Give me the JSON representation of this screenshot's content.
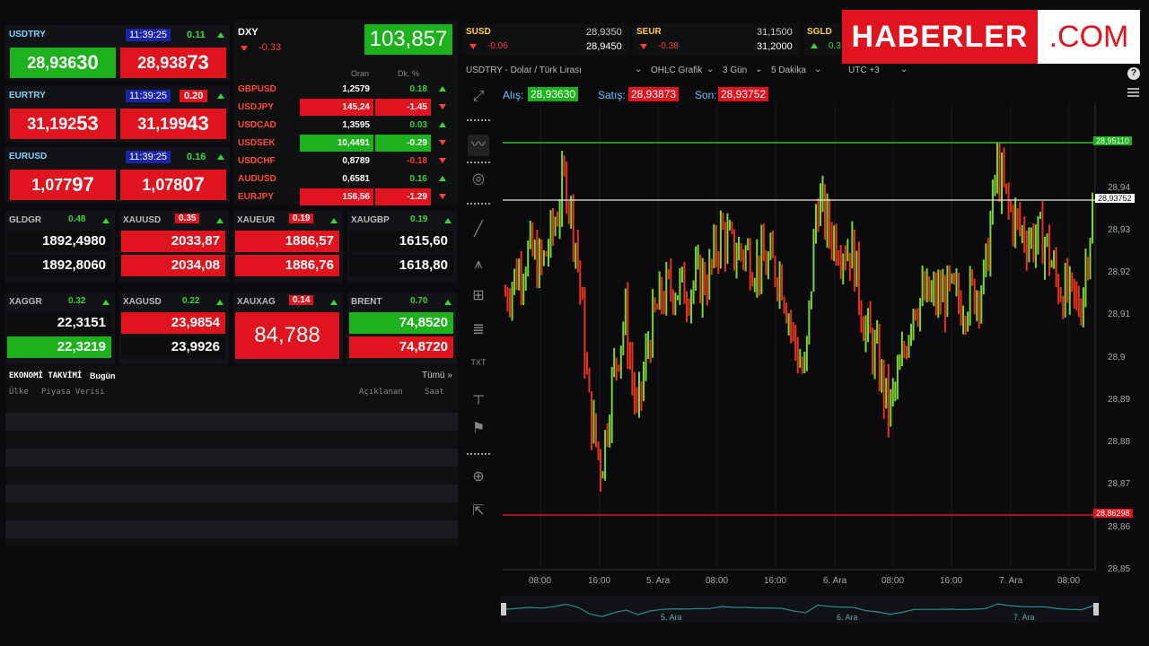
{
  "brand": {
    "name": "HABERLER",
    "suffix": ".COM"
  },
  "help_icon": "question-icon",
  "menu_icon": "hamburger-icon",
  "fx_cards": [
    {
      "symbol": "USDTRY",
      "time": "11:39:25",
      "change": "0.11",
      "dir": "up",
      "bid_main": "28,936",
      "bid_tail": "30",
      "ask_main": "28,938",
      "ask_tail": "73",
      "bid_color": "green",
      "ask_color": "red"
    },
    {
      "symbol": "EURTRY",
      "time": "11:39:25",
      "change": "0.20",
      "dir": "up",
      "bid_main": "31,192",
      "bid_tail": "53",
      "ask_main": "31,199",
      "ask_tail": "43",
      "bid_color": "red",
      "ask_color": "red"
    },
    {
      "symbol": "EURUSD",
      "time": "11:39:25",
      "change": "0.16",
      "dir": "up",
      "bid_main": "1,077",
      "bid_tail": "97",
      "ask_main": "1,078",
      "ask_tail": "07",
      "bid_color": "red",
      "ask_color": "red"
    }
  ],
  "dxy": {
    "symbol": "DXY",
    "change": "-0.33",
    "value": "103,857"
  },
  "fx_table": {
    "col_rate": "Oran",
    "col_pct": "Dk. %",
    "rows": [
      {
        "name": "GBPUSD",
        "rate": "1,2579",
        "pct": "0.18",
        "dir": "up",
        "rate_bg": "",
        "pct_bg": ""
      },
      {
        "name": "USDJPY",
        "rate": "145,24",
        "pct": "-1.45",
        "dir": "down",
        "rate_bg": "red",
        "pct_bg": "red"
      },
      {
        "name": "USDCAD",
        "rate": "1,3595",
        "pct": "0.03",
        "dir": "up",
        "rate_bg": "",
        "pct_bg": ""
      },
      {
        "name": "USDSEK",
        "rate": "10,4491",
        "pct": "-0.29",
        "dir": "down",
        "rate_bg": "green",
        "pct_bg": "green"
      },
      {
        "name": "USDCHF",
        "rate": "0,8789",
        "pct": "-0.18",
        "dir": "down",
        "rate_bg": "",
        "pct_bg": ""
      },
      {
        "name": "AUDUSD",
        "rate": "0,6581",
        "pct": "0.16",
        "dir": "up",
        "rate_bg": "",
        "pct_bg": ""
      },
      {
        "name": "EURJPY",
        "rate": "156,56",
        "pct": "-1.29",
        "dir": "down",
        "rate_bg": "red",
        "pct_bg": "red"
      }
    ]
  },
  "metals_row1": [
    {
      "symbol": "GLDGR",
      "change": "0.48",
      "dir": "up",
      "bid": "1892,4980",
      "ask": "1892,8060",
      "bid_bg": "none",
      "ask_bg": "none"
    },
    {
      "symbol": "XAUUSD",
      "change": "0.35",
      "dir": "up",
      "bid": "2033,87",
      "ask": "2034,08",
      "bid_bg": "red",
      "ask_bg": "red"
    },
    {
      "symbol": "XAUEUR",
      "change": "0.19",
      "dir": "up",
      "bid": "1886,57",
      "ask": "1886,76",
      "bid_bg": "red",
      "ask_bg": "red"
    },
    {
      "symbol": "XAUGBP",
      "change": "0.19",
      "dir": "up",
      "bid": "1615,60",
      "ask": "1618,80",
      "bid_bg": "none",
      "ask_bg": "none"
    }
  ],
  "metals_row2": [
    {
      "symbol": "XAGGR",
      "change": "0.32",
      "dir": "up",
      "bid": "22,3151",
      "ask": "22,3219",
      "bid_bg": "none",
      "ask_bg": "green"
    },
    {
      "symbol": "XAGUSD",
      "change": "0.22",
      "dir": "up",
      "bid": "23,9854",
      "ask": "23,9926",
      "bid_bg": "red",
      "ask_bg": "none"
    },
    {
      "symbol": "XAUXAG",
      "change": "0.14",
      "dir": "up",
      "value": "84,788"
    },
    {
      "symbol": "BRENT",
      "change": "0.70",
      "dir": "up",
      "bid": "74,8520",
      "ask": "74,8720",
      "bid_bg": "green",
      "ask_bg": "red"
    }
  ],
  "calendar": {
    "title": "EKONOMİ TAKVİMİ",
    "today": "Bugün",
    "all": "Tümü »",
    "col_country": "Ülke",
    "col_data": "Piyasa Verisi",
    "col_announced": "Açıklanan",
    "col_time": "Saat"
  },
  "top_tickers": [
    {
      "symbol": "SUSD",
      "change": "-0.06",
      "v1": "28,9350",
      "v2": "28,9450"
    },
    {
      "symbol": "SEUR",
      "change": "-0.38",
      "v1": "31,1500",
      "v2": "31,2000"
    },
    {
      "symbol": "SGLD",
      "change": "0.3"
    }
  ],
  "chart_toolbar": {
    "instrument": "USDTRY - Dolar / Türk Lirası",
    "chart_type": "OHLC Grafik",
    "range": "3 Gün",
    "interval": "5 Dakika",
    "tz": "UTC +3"
  },
  "quote": {
    "bid_label": "Alış:",
    "bid": "28,93630",
    "ask_label": "Satış:",
    "ask": "28,93873",
    "last_label": "Son:",
    "last": "28,93752"
  },
  "levels": {
    "high": "28,95110",
    "last": "28,93752",
    "low": "28,86298"
  },
  "colors": {
    "up": "#3bd43b",
    "down": "#ff3b3b",
    "green_bg": "#1db21d",
    "red_bg": "#e0141f"
  },
  "chart_data": {
    "type": "line",
    "title": "USDTRY - Dolar / Türk Lirası",
    "ylim": [
      28.85,
      28.96
    ],
    "y_ticks": [
      "28,94",
      "28,93",
      "28,92",
      "28,91",
      "28,9",
      "28,89",
      "28,88",
      "28,87",
      "28,86",
      "28,85"
    ],
    "x_ticks": [
      "08:00",
      "16:00",
      "5. Ara",
      "08:00",
      "16:00",
      "6. Ara",
      "08:00",
      "16:00",
      "7. Ara",
      "08:00"
    ],
    "navigator_labels": [
      "5. Ara",
      "6. Ara",
      "7. Ara"
    ],
    "x": [
      0,
      1,
      2,
      3,
      4,
      5,
      6,
      7,
      8,
      9,
      10,
      11,
      12,
      13,
      14,
      15,
      16,
      17,
      18,
      19,
      20,
      21,
      22,
      23,
      24,
      25,
      26,
      27,
      28,
      29,
      30,
      31,
      32,
      33,
      34,
      35,
      36,
      37,
      38,
      39,
      40,
      41,
      42,
      43,
      44,
      45,
      46,
      47,
      48,
      49
    ],
    "values": [
      28.915,
      28.92,
      28.925,
      28.921,
      28.93,
      28.943,
      28.925,
      28.888,
      28.874,
      28.896,
      28.91,
      28.885,
      28.905,
      28.914,
      28.917,
      28.916,
      28.918,
      28.919,
      28.93,
      28.925,
      28.925,
      28.922,
      28.922,
      28.92,
      28.905,
      28.895,
      28.938,
      28.93,
      28.927,
      28.925,
      28.907,
      28.9,
      28.887,
      28.897,
      28.913,
      28.914,
      28.914,
      28.915,
      28.913,
      28.915,
      28.918,
      28.945,
      28.935,
      28.93,
      28.928,
      28.928,
      28.918,
      28.914,
      28.912,
      28.935
    ],
    "series": [
      {
        "values": [
          28.915
        ]
      }
    ]
  }
}
